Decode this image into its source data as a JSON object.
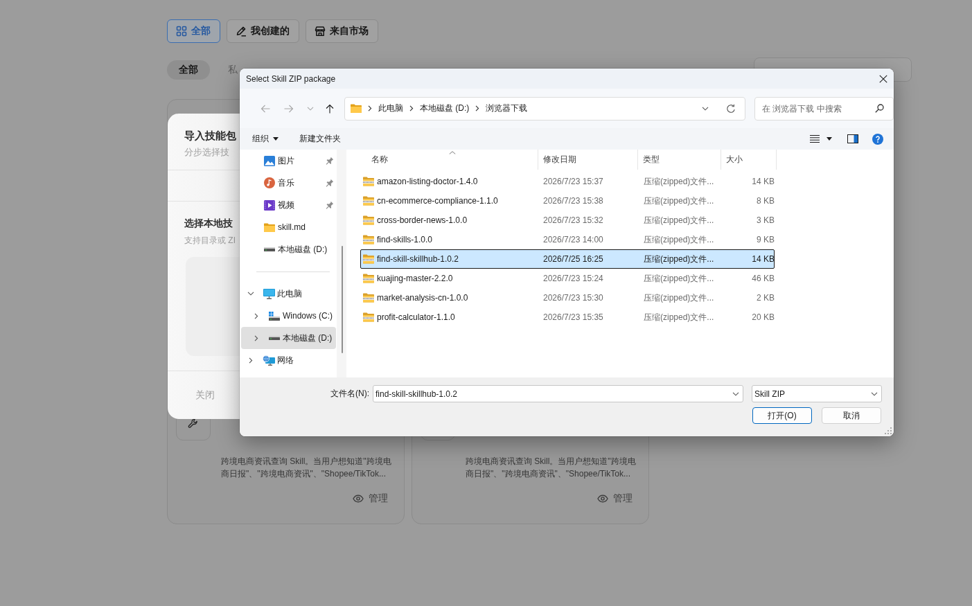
{
  "source_tabs": [
    {
      "label": "全部",
      "kind": "grid",
      "selected": true
    },
    {
      "label": "我创建的",
      "kind": "pencil",
      "selected": false
    },
    {
      "label": "来自市场",
      "kind": "store",
      "selected": false
    }
  ],
  "status_filters": [
    {
      "label": "全部",
      "selected": true
    },
    {
      "label": "私",
      "selected": false
    }
  ],
  "skill_cards": [
    {
      "description": "跨境电商资讯查询 Skill。当用户想知道\"跨境电商日报\"、\"跨境电商资讯\"、\"Shopee/TikTok...",
      "action": "管理"
    },
    {
      "description": "跨境电商资讯查询 Skill。当用户想知道\"跨境电商日报\"、\"跨境电商资讯\"、\"Shopee/TikTok...",
      "action": "管理"
    }
  ],
  "import_modal": {
    "title": "导入技能包",
    "subtitle": "分步选择技",
    "section_title": "选择本地技",
    "section_hint": "支持目录或 ZI",
    "close_button": "关闭"
  },
  "file_dialog": {
    "title": "Select Skill ZIP package",
    "nav_buttons": [
      {
        "kind": "back",
        "disabled": true
      },
      {
        "kind": "forward",
        "disabled": true
      },
      {
        "kind": "recent",
        "disabled": true
      },
      {
        "kind": "up",
        "disabled": false
      }
    ],
    "breadcrumbs": [
      "此电脑",
      "本地磁盘 (D:)",
      "浏览器下载"
    ],
    "search": {
      "placeholder": "在 浏览器下载 中搜索"
    },
    "toolbar": {
      "organize": "组织",
      "new_folder": "新建文件夹"
    },
    "nav_pane": {
      "quick_access": [
        {
          "label": "图片",
          "kind": "pictures",
          "pinned": true,
          "selected": false
        },
        {
          "label": "音乐",
          "kind": "music",
          "pinned": true,
          "selected": false
        },
        {
          "label": "视频",
          "kind": "videos",
          "pinned": true,
          "selected": false
        },
        {
          "label": "skill.md",
          "kind": "folder",
          "pinned": false,
          "selected": false
        },
        {
          "label": "本地磁盘 (D:)",
          "kind": "drive",
          "pinned": false,
          "selected": false
        }
      ],
      "tree": [
        {
          "label": "此电脑",
          "kind": "computer",
          "expanded": true,
          "selected": false,
          "children": [
            {
              "label": "Windows (C:)",
              "kind": "windows-drive",
              "expanded": false,
              "selected": false
            },
            {
              "label": "本地磁盘 (D:)",
              "kind": "drive",
              "expanded": false,
              "selected": true
            }
          ]
        },
        {
          "label": "网络",
          "kind": "network",
          "expanded": false,
          "selected": false
        }
      ]
    },
    "columns": [
      {
        "label": "名称",
        "sorted": true
      },
      {
        "label": "修改日期",
        "sorted": false
      },
      {
        "label": "类型",
        "sorted": false
      },
      {
        "label": "大小",
        "sorted": false
      }
    ],
    "files": [
      {
        "name": "amazon-listing-doctor-1.4.0",
        "modified": "2026/7/23 15:37",
        "type": "压缩(zipped)文件...",
        "size": "14 KB",
        "selected": false
      },
      {
        "name": "cn-ecommerce-compliance-1.1.0",
        "modified": "2026/7/23 15:38",
        "type": "压缩(zipped)文件...",
        "size": "8 KB",
        "selected": false
      },
      {
        "name": "cross-border-news-1.0.0",
        "modified": "2026/7/23 15:32",
        "type": "压缩(zipped)文件...",
        "size": "3 KB",
        "selected": false
      },
      {
        "name": "find-skills-1.0.0",
        "modified": "2026/7/23 14:00",
        "type": "压缩(zipped)文件...",
        "size": "9 KB",
        "selected": false
      },
      {
        "name": "find-skill-skillhub-1.0.2",
        "modified": "2026/7/25 16:25",
        "type": "压缩(zipped)文件...",
        "size": "14 KB",
        "selected": true
      },
      {
        "name": "kuajing-master-2.2.0",
        "modified": "2026/7/23 15:24",
        "type": "压缩(zipped)文件...",
        "size": "46 KB",
        "selected": false
      },
      {
        "name": "market-analysis-cn-1.0.0",
        "modified": "2026/7/23 15:30",
        "type": "压缩(zipped)文件...",
        "size": "2 KB",
        "selected": false
      },
      {
        "name": "profit-calculator-1.1.0",
        "modified": "2026/7/23 15:35",
        "type": "压缩(zipped)文件...",
        "size": "20 KB",
        "selected": false
      }
    ],
    "file_name_label": "文件名(N):",
    "file_name": "find-skill-skillhub-1.0.2",
    "file_type": "Skill ZIP",
    "buttons": [
      {
        "label": "打开(O)",
        "default": true
      },
      {
        "label": "取消",
        "default": false
      }
    ]
  }
}
